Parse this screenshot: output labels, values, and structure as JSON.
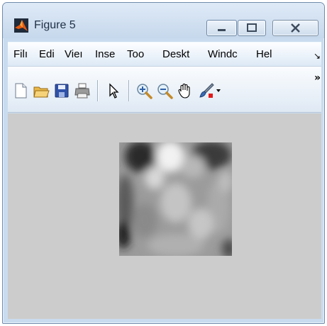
{
  "window": {
    "title": "Figure 5"
  },
  "menu": [
    "Filı",
    "Edi",
    "Vieı",
    "Inse",
    "Too",
    "Deskt",
    "Windc",
    "Hel"
  ],
  "toolbar": {
    "tools": [
      "new-figure-icon",
      "open-file-icon",
      "save-icon",
      "print-icon",
      "edit-plot-arrow-icon",
      "zoom-in-icon",
      "zoom-out-icon",
      "pan-hand-icon",
      "data-brush-icon"
    ]
  },
  "colors": {
    "figure_bg": "#cccccc",
    "window_chrome": "#c9dcef",
    "brand_orange": "#e45a12"
  },
  "figure": {
    "content": "grayscale image"
  }
}
